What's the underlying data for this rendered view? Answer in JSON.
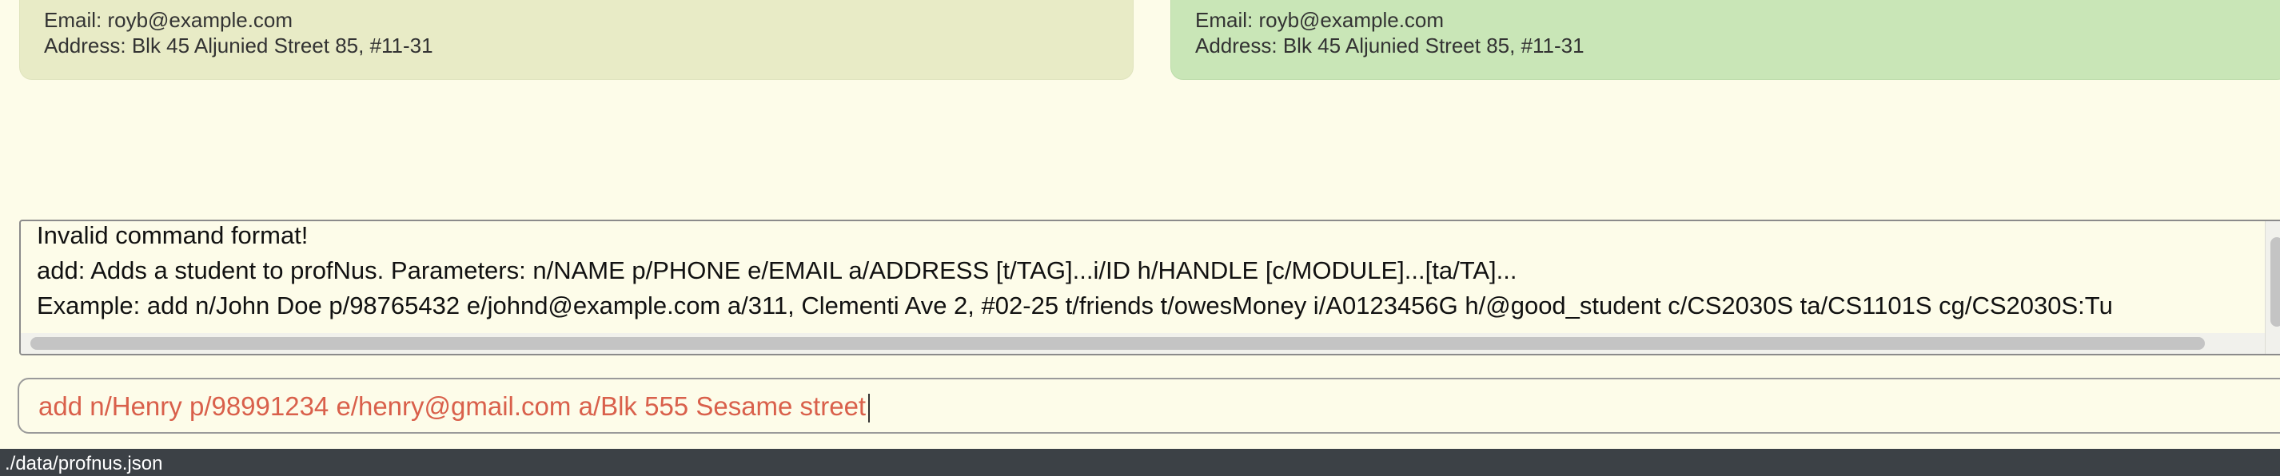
{
  "person_cards": [
    {
      "email": "Email: royb@example.com",
      "address": "Address: Blk 45 Aljunied Street 85, #11-31",
      "bg_color": "#e8ebc6"
    },
    {
      "email": "Email: royb@example.com",
      "address": "Address: Blk 45 Aljunied Street 85, #11-31",
      "bg_color": "#c9e6b7"
    }
  ],
  "result_display": {
    "lines": [
      "Invalid command format!",
      "add: Adds a student to profNus. Parameters: n/NAME p/PHONE e/EMAIL a/ADDRESS [t/TAG]...i/ID h/HANDLE [c/MODULE]...[ta/TA]...",
      "Example: add n/John Doe p/98765432 e/johnd@example.com a/311, Clementi Ave 2, #02-25 t/friends t/owesMoney i/A0123456G h/@good_student c/CS2030S ta/CS1101S cg/CS2030S:Tu"
    ]
  },
  "command_box": {
    "value": "add n/Henry p/98991234 e/henry@gmail.com a/Blk 555 Sesame street",
    "text_color": "#d9604b"
  },
  "status_bar": {
    "path": "./data/profnus.json"
  }
}
